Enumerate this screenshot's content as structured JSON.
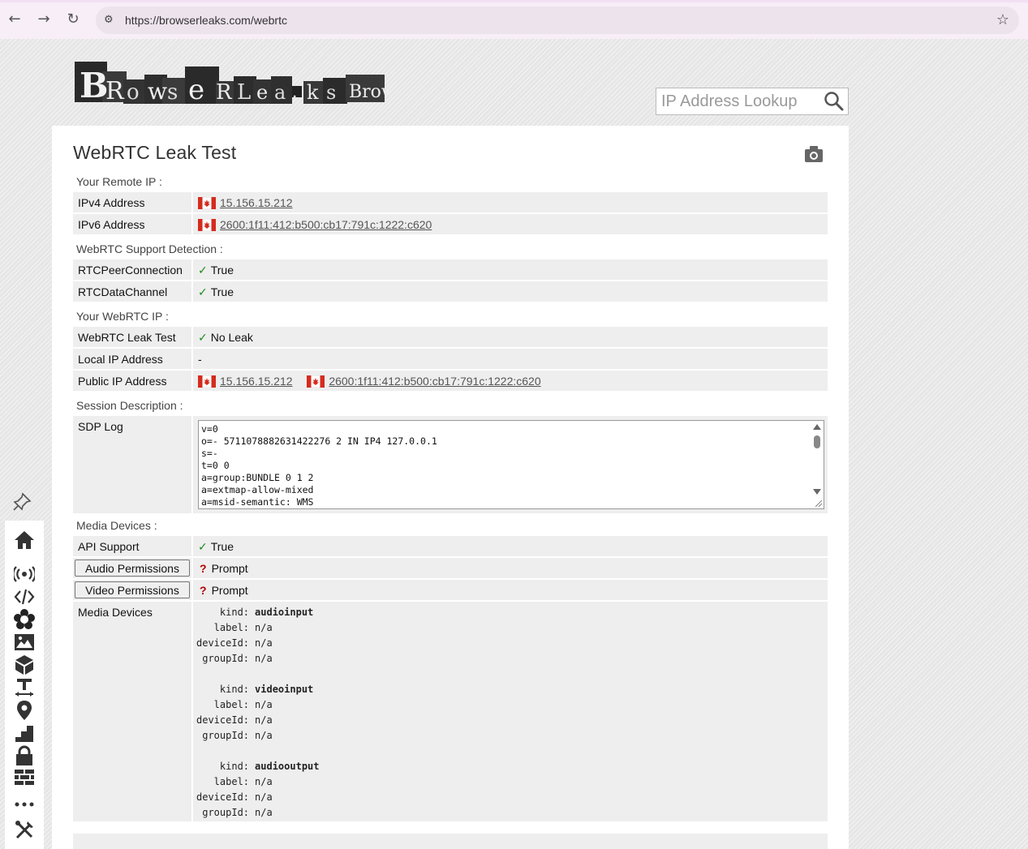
{
  "browser": {
    "url": "https://browserleaks.com/webrtc"
  },
  "header": {
    "logo_text": "BrowserLeaks.com",
    "search_placeholder": "IP Address Lookup"
  },
  "page": {
    "title": "WebRTC Leak Test"
  },
  "remote_ip": {
    "label": "Your Remote IP :",
    "ipv4_key": "IPv4 Address",
    "ipv4_value": "15.156.15.212",
    "ipv6_key": "IPv6 Address",
    "ipv6_value": "2600:1f11:412:b500:cb17:791c:1222:c620"
  },
  "support": {
    "label": "WebRTC Support Detection :",
    "peer_key": "RTCPeerConnection",
    "peer_value": "True",
    "channel_key": "RTCDataChannel",
    "channel_value": "True"
  },
  "webrtc_ip": {
    "label": "Your WebRTC IP :",
    "leak_key": "WebRTC Leak Test",
    "leak_value": "No Leak",
    "local_key": "Local IP Address",
    "local_value": "-",
    "public_key": "Public IP Address",
    "public_ipv4": "15.156.15.212",
    "public_ipv6": "2600:1f11:412:b500:cb17:791c:1222:c620"
  },
  "session": {
    "label": "Session Description :",
    "sdp_key": "SDP Log",
    "sdp_lines": "v=0\no=- 5711078882631422276 2 IN IP4 127.0.0.1\ns=-\nt=0 0\na=group:BUNDLE 0 1 2\na=extmap-allow-mixed\na=msid-semantic: WMS"
  },
  "media": {
    "label": "Media Devices :",
    "api_key": "API Support",
    "api_value": "True",
    "audio_btn": "Audio Permissions",
    "audio_value": "Prompt",
    "video_btn": "Video Permissions",
    "video_value": "Prompt",
    "devices_key": "Media Devices",
    "devices": [
      {
        "kind": "audioinput",
        "label": "n/a",
        "deviceId": "n/a",
        "groupId": "n/a"
      },
      {
        "kind": "videoinput",
        "label": "n/a",
        "deviceId": "n/a",
        "groupId": "n/a"
      },
      {
        "kind": "audiooutput",
        "label": "n/a",
        "deviceId": "n/a",
        "groupId": "n/a"
      }
    ],
    "field_labels": {
      "kind": "kind:",
      "label": "label:",
      "deviceId": "deviceId:",
      "groupId": "groupId:"
    }
  },
  "colors": {
    "check": "#1a8a1a",
    "question": "#b00000",
    "row_bg": "#eeeeee"
  },
  "icons": {
    "sidebar": [
      "pin-icon",
      "home-icon",
      "broadcast-icon",
      "code-icon",
      "flower-icon",
      "image-icon",
      "cube-icon",
      "text-size-icon",
      "location-icon",
      "stairs-icon",
      "lock-icon",
      "wall-icon",
      "more-icon",
      "tools-icon"
    ]
  }
}
